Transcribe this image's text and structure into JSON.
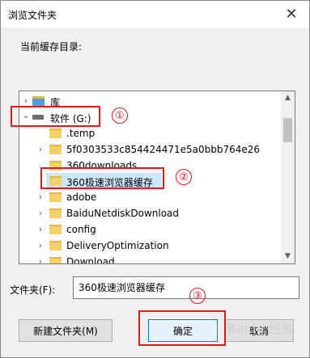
{
  "dialog": {
    "title": "浏览文件夹",
    "close_glyph": "✕",
    "current_dir_label": "当前缓存目录:"
  },
  "tree": {
    "rows": [
      {
        "label": "库",
        "arrow": "›"
      },
      {
        "label": "软件 (G:)",
        "arrow": "⌄"
      },
      {
        "label": ".temp",
        "arrow": ""
      },
      {
        "label": "5f0303533c854424471e5a0bbb764e26",
        "arrow": "›"
      },
      {
        "label": "360downloads",
        "arrow": ""
      },
      {
        "label": "360极速浏览器缓存",
        "arrow": ""
      },
      {
        "label": "adobe",
        "arrow": "›"
      },
      {
        "label": "BaiduNetdiskDownload",
        "arrow": "›"
      },
      {
        "label": "config",
        "arrow": "›"
      },
      {
        "label": "DeliveryOptimization",
        "arrow": "›"
      },
      {
        "label": "Download",
        "arrow": "›"
      }
    ],
    "selected_index": 5,
    "scroll_up": "▲",
    "scroll_down": "▼"
  },
  "annotations": {
    "step1": "①",
    "step2": "②",
    "step3": "③",
    "color": "#e0181e"
  },
  "folder_field": {
    "label": "文件夹(F):",
    "value": "360极速浏览器缓存"
  },
  "buttons": {
    "new_folder": "新建文件夹(M)",
    "ok": "确定",
    "cancel": "取消"
  },
  "watermark": "Baidu 经验"
}
